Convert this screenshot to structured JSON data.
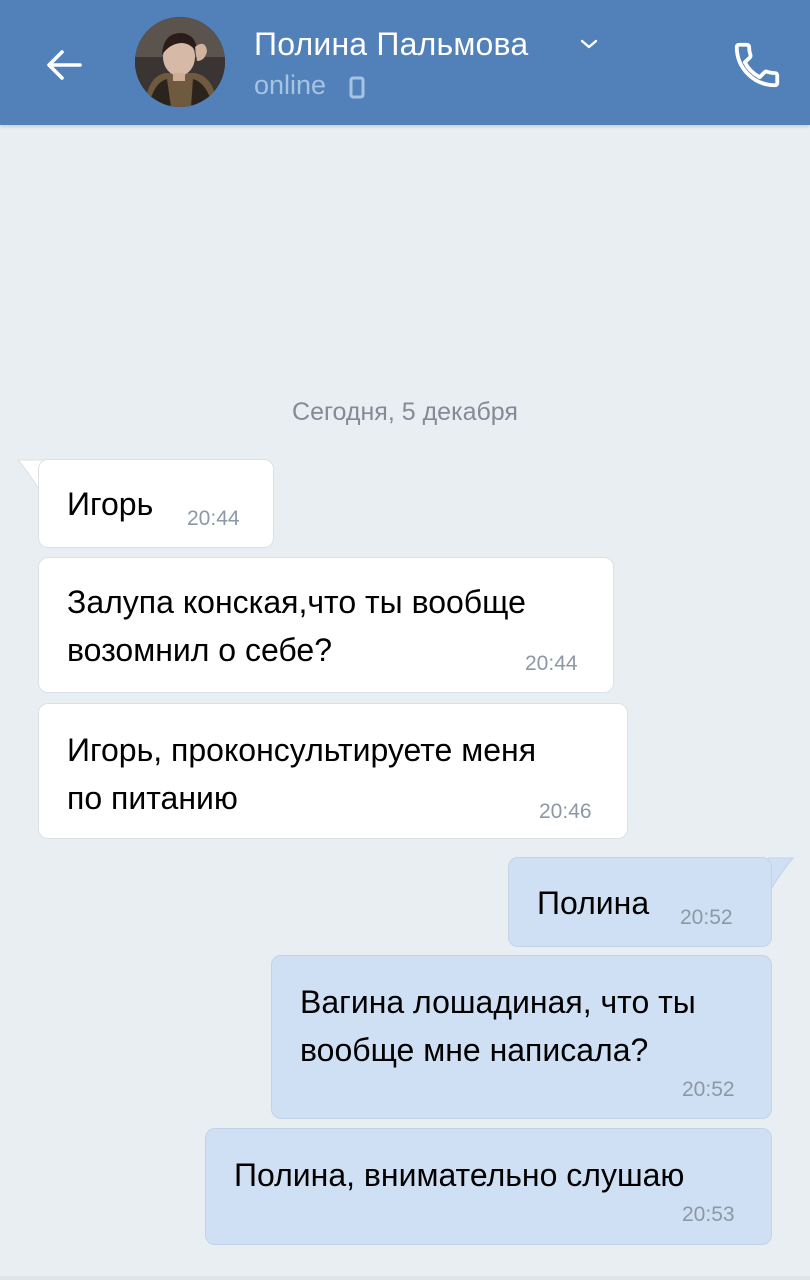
{
  "header": {
    "title": "Полина Пальмова",
    "status": "online"
  },
  "chat": {
    "date_separator": "Сегодня, 5 декабря",
    "messages": [
      {
        "direction": "incoming",
        "lines": [
          "Игорь"
        ],
        "time": "20:44"
      },
      {
        "direction": "incoming",
        "lines": [
          "Залупа конская,что ты вообще",
          "возомнил о себе?"
        ],
        "time": "20:44"
      },
      {
        "direction": "incoming",
        "lines": [
          "Игорь, проконсультируете меня",
          "по питанию"
        ],
        "time": "20:46"
      },
      {
        "direction": "outgoing",
        "lines": [
          "Полина"
        ],
        "time": "20:52"
      },
      {
        "direction": "outgoing",
        "lines": [
          "Вагина лошадиная, что ты",
          "вообще мне написала?"
        ],
        "time": "20:52"
      },
      {
        "direction": "outgoing",
        "lines": [
          "Полина, внимательно слушаю"
        ],
        "time": "20:53"
      }
    ]
  },
  "colors": {
    "header_bg": "#5181b8",
    "chat_bg": "#e9eef2",
    "incoming_bubble": "#ffffff",
    "outgoing_bubble": "#cfe0f4",
    "status_text": "#a7c3e3"
  },
  "icons": [
    "back-arrow-icon",
    "chevron-down-icon",
    "mobile-phone-icon",
    "phone-call-icon"
  ]
}
